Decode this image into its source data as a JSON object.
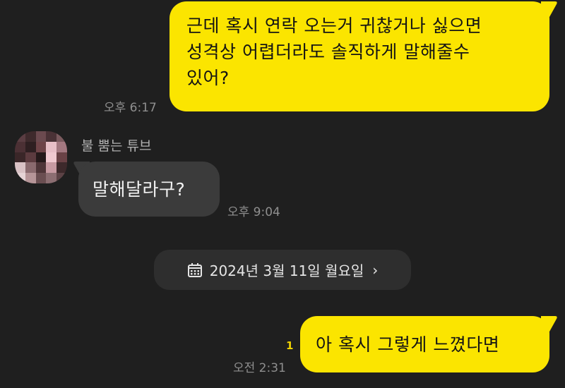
{
  "messages": {
    "msg1": {
      "lines": [
        "근데 혹시 연락 오는거 귀찮거나 싫으면",
        "성격상 어렵더라도 솔직하게 말해줄수",
        "있어?"
      ],
      "time": "오후 6:17"
    },
    "msg2": {
      "sender": "불 뿜는 튜브",
      "text": "말해달라구?",
      "time": "오후 9:04"
    },
    "msg3": {
      "text": "아 혹시 그렇게 느꼈다면",
      "time": "오전 2:31",
      "unread": "1"
    }
  },
  "date_divider": {
    "icon": "calendar-icon",
    "label": "2024년 3월 11일 월요일",
    "chevron": "›"
  },
  "colors": {
    "background": "#1f1f1f",
    "outgoing_bubble": "#fbe500",
    "incoming_bubble": "#3b3b3b",
    "unread_count": "#f2d300"
  }
}
